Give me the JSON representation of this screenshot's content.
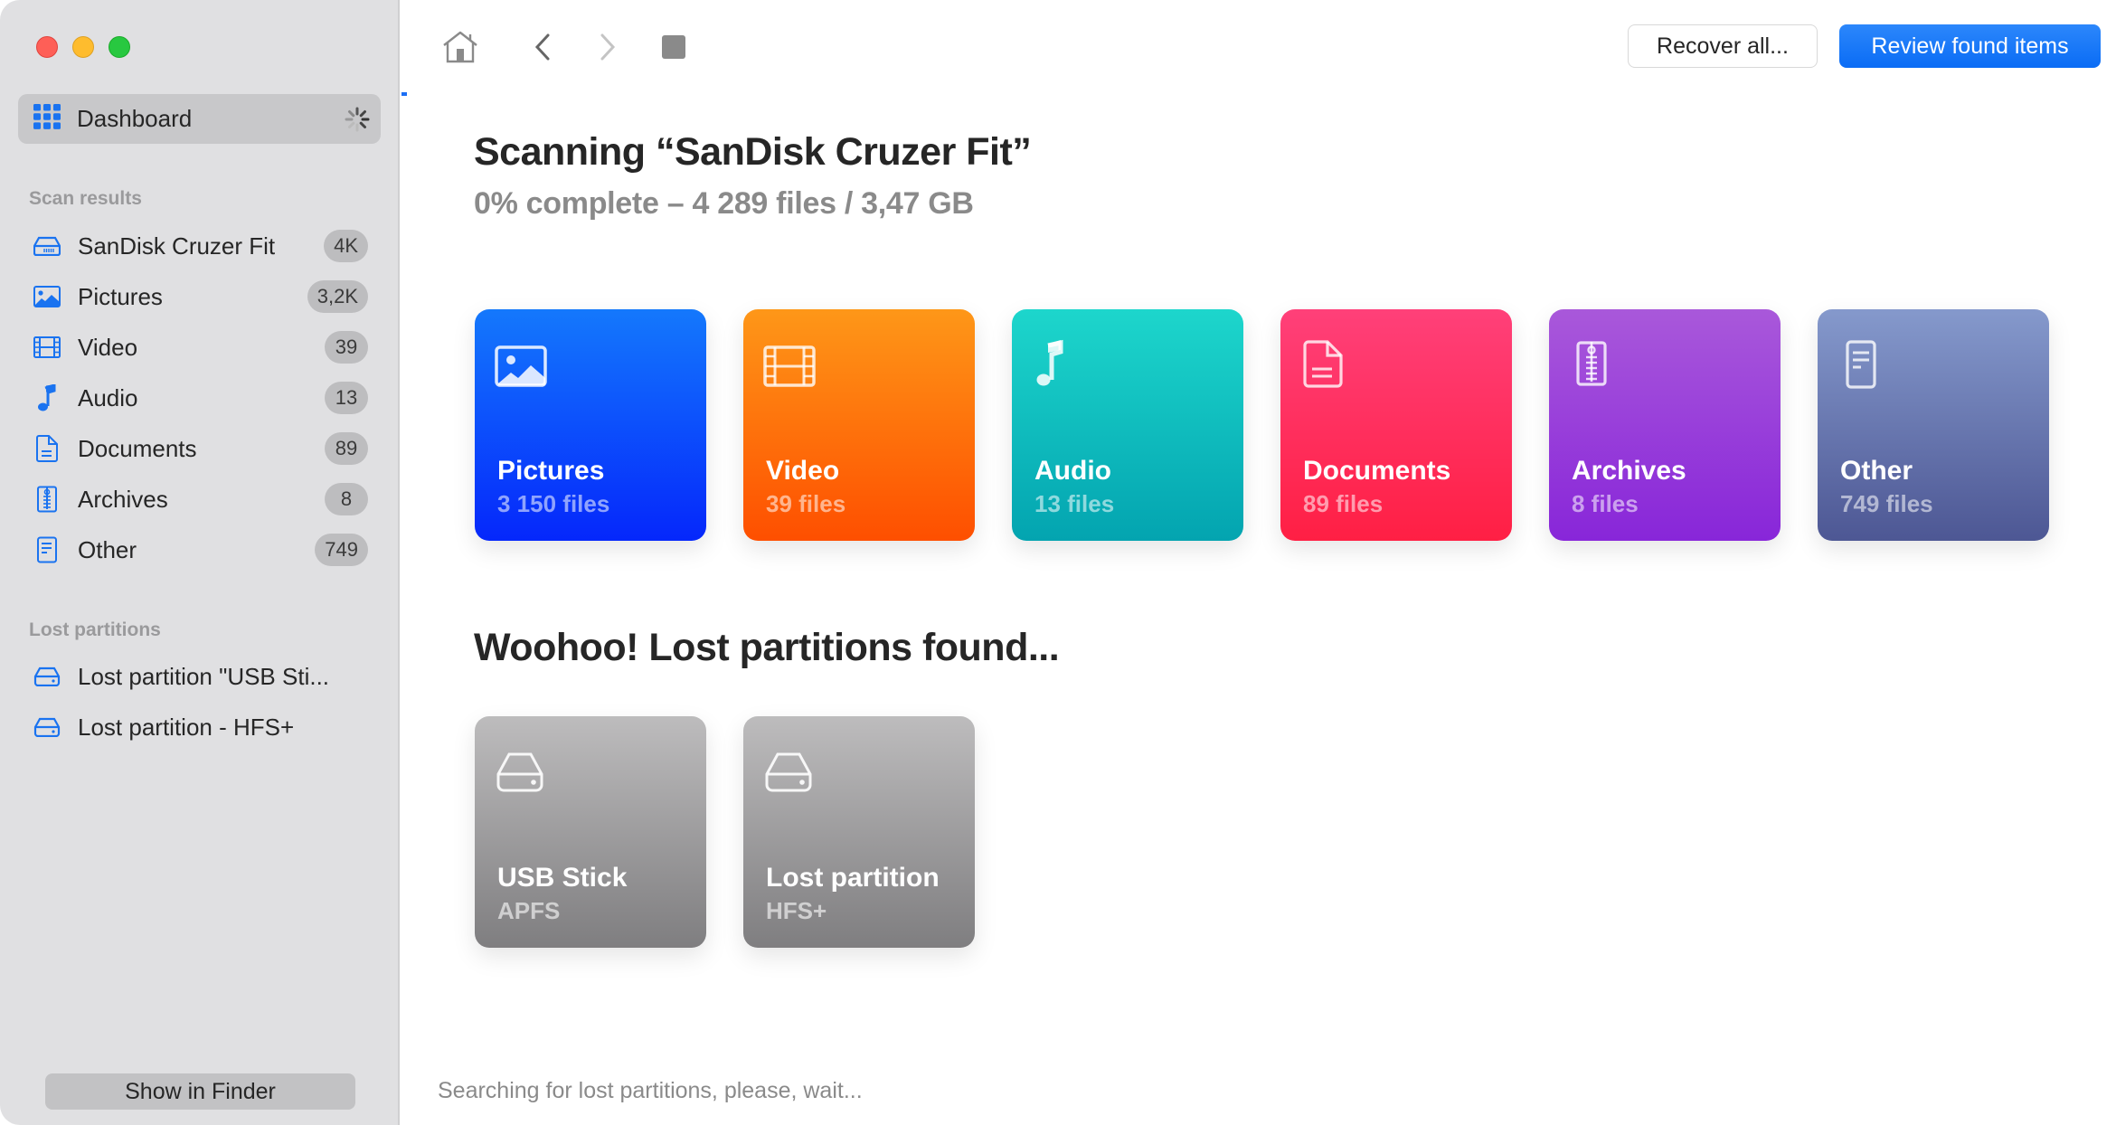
{
  "window": {
    "controls": [
      "close",
      "minimize",
      "zoom"
    ]
  },
  "sidebar": {
    "dashboard": {
      "label": "Dashboard",
      "icon": "grid-icon",
      "status": "loading-spinner"
    },
    "scan_results_label": "Scan results",
    "scan_results": [
      {
        "label": "SanDisk Cruzer Fit",
        "badge": "4K",
        "icon": "drive-icon"
      },
      {
        "label": "Pictures",
        "badge": "3,2K",
        "icon": "picture-icon"
      },
      {
        "label": "Video",
        "badge": "39",
        "icon": "film-icon"
      },
      {
        "label": "Audio",
        "badge": "13",
        "icon": "music-note-icon"
      },
      {
        "label": "Documents",
        "badge": "89",
        "icon": "document-icon"
      },
      {
        "label": "Archives",
        "badge": "8",
        "icon": "archive-icon"
      },
      {
        "label": "Other",
        "badge": "749",
        "icon": "other-file-icon"
      }
    ],
    "lost_partitions_label": "Lost partitions",
    "lost_partitions": [
      {
        "label": "Lost partition \"USB Sti...",
        "icon": "hard-drive-icon"
      },
      {
        "label": "Lost partition - HFS+",
        "icon": "hard-drive-icon"
      }
    ],
    "show_in_finder": "Show in Finder"
  },
  "toolbar": {
    "home": "home-icon",
    "back": "chevron-left-icon",
    "forward": "chevron-right-icon",
    "stop": "stop-icon",
    "recover_all": "Recover all...",
    "review_found": "Review found items"
  },
  "scan": {
    "progress_percent": 0,
    "title": "Scanning “SanDisk Cruzer Fit”",
    "subtitle": "0% complete – 4 289 files / 3,47 GB"
  },
  "categories": [
    {
      "title": "Pictures",
      "sub": "3 150 files",
      "icon": "picture-icon",
      "gradient": [
        "#1478fc",
        "#0527fb"
      ]
    },
    {
      "title": "Video",
      "sub": "39 files",
      "icon": "film-icon",
      "gradient": [
        "#fe9718",
        "#fe4f00"
      ]
    },
    {
      "title": "Audio",
      "sub": "13 files",
      "icon": "music-note-icon",
      "gradient": [
        "#1dd6cc",
        "#03a4b0"
      ]
    },
    {
      "title": "Documents",
      "sub": "89 files",
      "icon": "document-icon",
      "gradient": [
        "#ff4079",
        "#ff1f44"
      ]
    },
    {
      "title": "Archives",
      "sub": "8 files",
      "icon": "archive-icon",
      "gradient": [
        "#a958da",
        "#8826d9"
      ]
    },
    {
      "title": "Other",
      "sub": "749 files",
      "icon": "other-file-icon",
      "gradient": [
        "#8599cc",
        "#4d5794"
      ]
    }
  ],
  "lost": {
    "title": "Woohoo! Lost partitions found...",
    "partitions": [
      {
        "title": "USB Stick",
        "sub": "APFS",
        "icon": "hard-drive-icon"
      },
      {
        "title": "Lost partition",
        "sub": "HFS+",
        "icon": "hard-drive-icon"
      }
    ]
  },
  "status": "Searching for lost partitions, please, wait...",
  "colors": {
    "accent": "#1b6ff5",
    "sidebar_icon": "#1a73f0"
  }
}
